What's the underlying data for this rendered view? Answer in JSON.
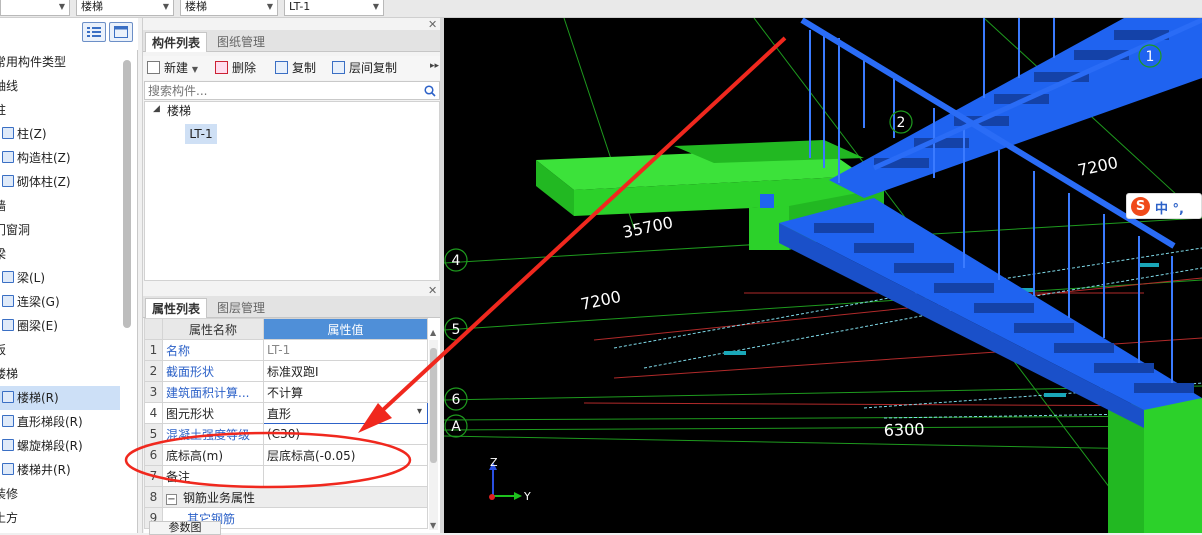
{
  "topbar": {
    "dropdown_2": "楼梯",
    "dropdown_3": "楼梯",
    "dropdown_4": "LT-1"
  },
  "left_tree": {
    "items": [
      {
        "label": "常用构件类型",
        "indent": 0
      },
      {
        "label": "轴线",
        "indent": 0
      },
      {
        "label": "柱",
        "indent": 0
      },
      {
        "label": "柱(Z)",
        "indent": 1
      },
      {
        "label": "构造柱(Z)",
        "indent": 1
      },
      {
        "label": "砌体柱(Z)",
        "indent": 1
      },
      {
        "label": "墙",
        "indent": 0
      },
      {
        "label": "门窗洞",
        "indent": 0
      },
      {
        "label": "梁",
        "indent": 0
      },
      {
        "label": "梁(L)",
        "indent": 1
      },
      {
        "label": "连梁(G)",
        "indent": 1
      },
      {
        "label": "圈梁(E)",
        "indent": 1
      },
      {
        "label": "板",
        "indent": 0
      },
      {
        "label": "楼梯",
        "indent": 0
      },
      {
        "label": "楼梯(R)",
        "indent": 1,
        "selected": true
      },
      {
        "label": "直形梯段(R)",
        "indent": 1
      },
      {
        "label": "螺旋梯段(R)",
        "indent": 1
      },
      {
        "label": "楼梯井(R)",
        "indent": 1
      },
      {
        "label": "装修",
        "indent": 0
      },
      {
        "label": "土方",
        "indent": 0
      }
    ]
  },
  "component_panel": {
    "tab_active": "构件列表",
    "tab_inactive": "图纸管理",
    "toolbar": {
      "new": "新建",
      "delete": "删除",
      "copy": "复制",
      "floor_copy": "层间复制"
    },
    "search_placeholder": "搜索构件...",
    "tree_root": "楼梯",
    "tree_child": "LT-1"
  },
  "property_panel": {
    "tab_active": "属性列表",
    "tab_inactive": "图层管理",
    "header_name": "属性名称",
    "header_value": "属性值",
    "rows": [
      {
        "num": "1",
        "name": "名称",
        "value": "LT-1"
      },
      {
        "num": "2",
        "name": "截面形状",
        "value": "标准双跑I"
      },
      {
        "num": "3",
        "name": "建筑面积计算...",
        "value": "不计算"
      },
      {
        "num": "4",
        "name": "图元形状",
        "value": "直形"
      },
      {
        "num": "5",
        "name": "混凝土强度等级",
        "value": "(C30)"
      },
      {
        "num": "6",
        "name": "底标高(m)",
        "value": "层底标高(-0.05)"
      },
      {
        "num": "7",
        "name": "备注",
        "value": ""
      },
      {
        "num": "8",
        "name": "钢筋业务属性",
        "value": ""
      },
      {
        "num": "9",
        "name": "其它钢筋",
        "value": ""
      }
    ],
    "bottom_tab": "参数图"
  },
  "viewport": {
    "labels": {
      "dim_35700": "35700",
      "dim_7200_a": "7200",
      "dim_7200_b": "7200",
      "dim_6300": "6300",
      "axis_1": "1",
      "axis_2": "2",
      "axis_4": "4",
      "axis_5": "5",
      "axis_6": "6",
      "axis_A": "A",
      "gizmo_z": "Z",
      "gizmo_y": "Y"
    },
    "ime": {
      "logo": "S",
      "text": "中 °,"
    }
  },
  "colors": {
    "accent_blue": "#4f8fd8",
    "stair_blue": "#1f63f0",
    "slab_green": "#2fd12a",
    "annotation_red": "#f0281e"
  }
}
